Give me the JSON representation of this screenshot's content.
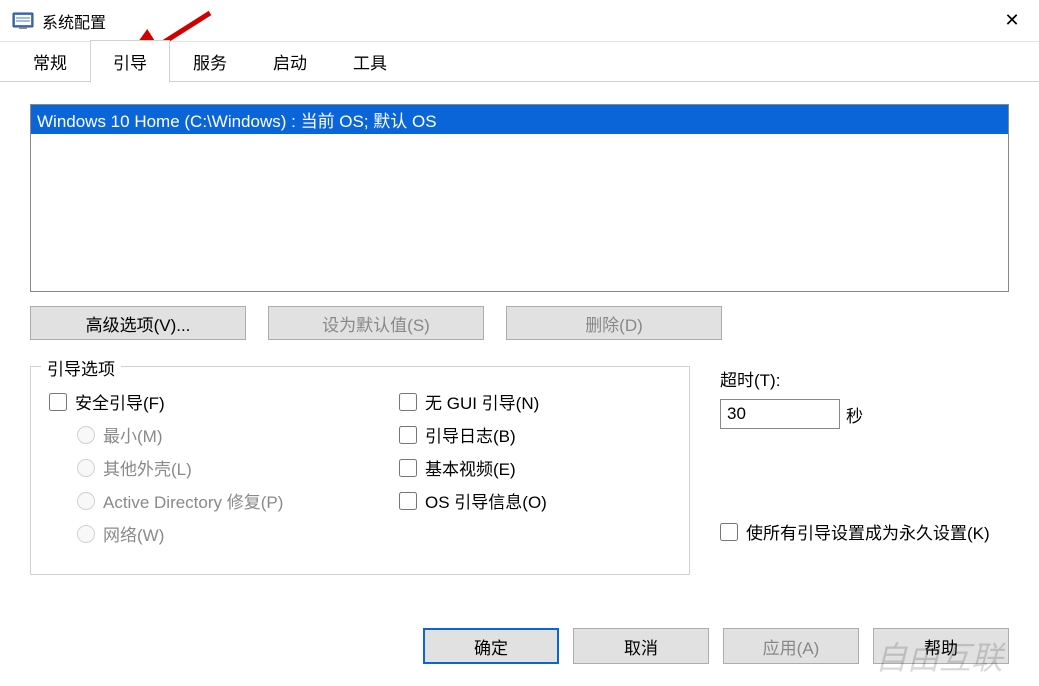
{
  "window": {
    "title": "系统配置",
    "close_icon": "✕"
  },
  "tabs": {
    "items": [
      "常规",
      "引导",
      "服务",
      "启动",
      "工具"
    ],
    "active_index": 1
  },
  "boot_list": {
    "selected": "Windows 10 Home (C:\\Windows) : 当前 OS; 默认 OS"
  },
  "buttons_row": {
    "advanced": "高级选项(V)...",
    "set_default": "设为默认值(S)",
    "delete": "删除(D)"
  },
  "boot_options": {
    "legend": "引导选项",
    "safe_boot": "安全引导(F)",
    "radios": {
      "minimal": "最小(M)",
      "alt_shell": "其他外壳(L)",
      "ad_repair": "Active Directory 修复(P)",
      "network": "网络(W)"
    },
    "no_gui": "无 GUI 引导(N)",
    "boot_log": "引导日志(B)",
    "base_video": "基本视频(E)",
    "os_boot_info": "OS 引导信息(O)"
  },
  "timeout": {
    "label": "超时(T):",
    "value": "30",
    "unit": "秒"
  },
  "permanent": {
    "label": "使所有引导设置成为永久设置(K)"
  },
  "dialog_buttons": {
    "ok": "确定",
    "cancel": "取消",
    "apply": "应用(A)",
    "help": "帮助"
  }
}
